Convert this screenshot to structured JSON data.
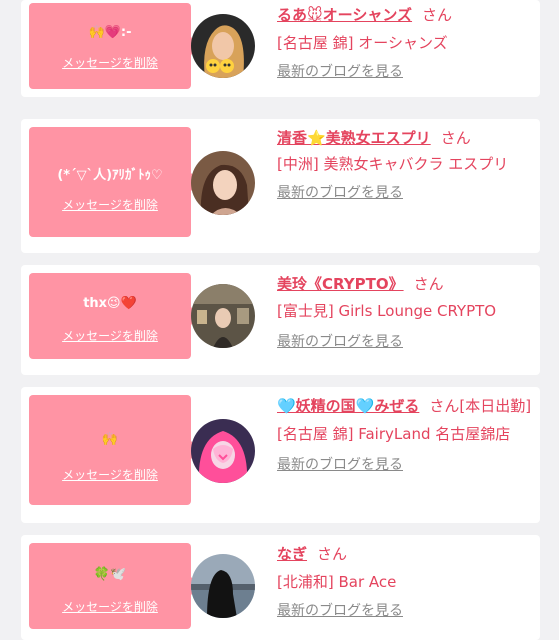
{
  "delete_label": "メッセージを削除",
  "san_label": "さん",
  "blog_label": "最新のブログを見る",
  "colors": {
    "accent_pink": "#ff94a4",
    "name_red": "#e4445e",
    "muted_gray": "#8a8a8a",
    "background": "#f1f1f3"
  },
  "entries": [
    {
      "message": "🙌💗:-",
      "name": "るあ🐭オーシャンズ",
      "shop": "[名古屋 錦] オーシャンズ",
      "avatar_icon": "blonde-woman-with-emoji-avatar"
    },
    {
      "message": "(*´▽`人)ｱﾘｶﾞﾄｩ♡",
      "name": "清香⭐美熟女エスプリ",
      "shop": "[中洲] 美熟女キャバクラ エスプリ",
      "avatar_icon": "woman-portrait-avatar"
    },
    {
      "message": "thx😉❤️",
      "name": "美玲《CRYPTO》",
      "shop": "[富士見] Girls Lounge CRYPTO",
      "avatar_icon": "woman-in-room-avatar"
    },
    {
      "message": "🙌",
      "name": "🩵妖精の国🩵みぜる",
      "name_suffix": "[本日出勤]",
      "shop": "[名古屋 錦] FairyLand 名古屋錦店",
      "avatar_icon": "pink-hair-woman-avatar"
    },
    {
      "message": "🍀🕊️",
      "name": "なぎ",
      "shop": "[北浦和] Bar Ace",
      "avatar_icon": "silhouette-sea-avatar"
    }
  ]
}
